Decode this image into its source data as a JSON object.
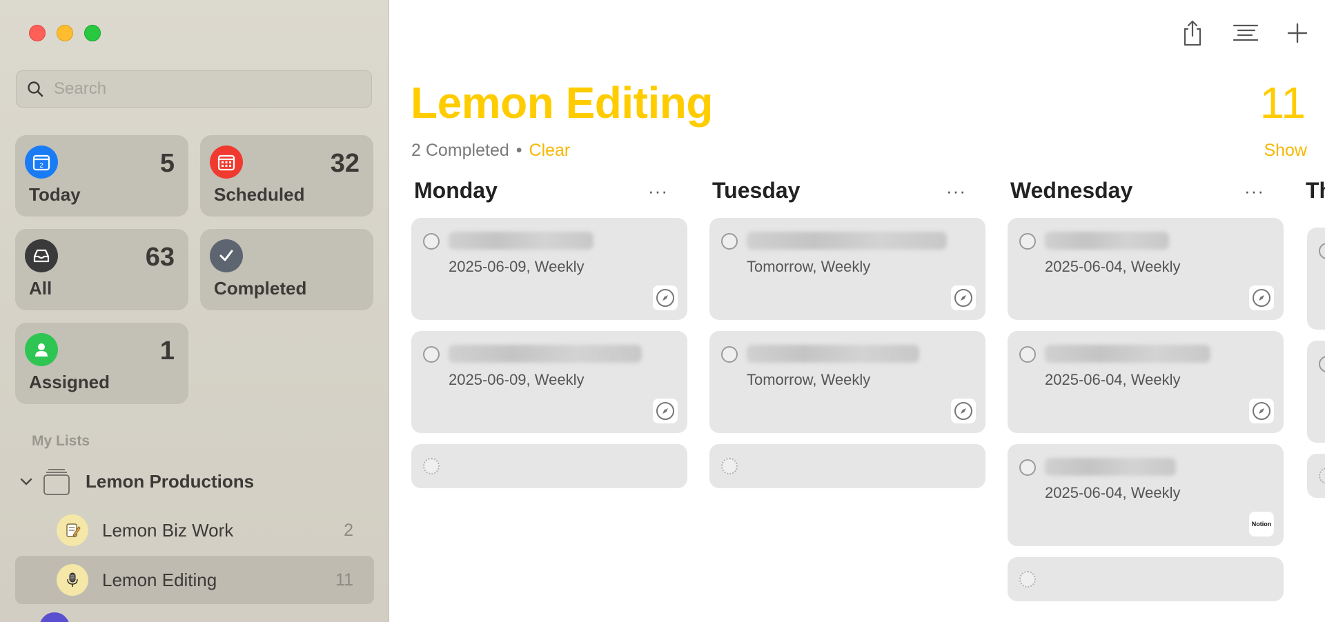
{
  "sidebar": {
    "search_placeholder": "Search",
    "smart_lists": [
      {
        "name": "Today",
        "count": "5",
        "icon": "calendar-day-icon",
        "color": "#1a7cf5"
      },
      {
        "name": "Scheduled",
        "count": "32",
        "icon": "calendar-grid-icon",
        "color": "#f03a2f"
      },
      {
        "name": "All",
        "count": "63",
        "icon": "tray-icon",
        "color": "#3a3a3a"
      },
      {
        "name": "Completed",
        "count": "",
        "icon": "checkmark-icon",
        "color": "#5d6570"
      },
      {
        "name": "Assigned",
        "count": "1",
        "icon": "person-icon",
        "color": "#2fc553"
      }
    ],
    "my_lists_header": "My Lists",
    "group": {
      "name": "Lemon Productions"
    },
    "lists": [
      {
        "name": "Lemon Biz Work",
        "count": "2",
        "icon": "notepad-icon"
      },
      {
        "name": "Lemon Editing",
        "count": "11",
        "icon": "microphone-icon",
        "selected": true
      }
    ]
  },
  "main": {
    "title": "Lemon Editing",
    "count": "11",
    "completed_text": "2 Completed",
    "separator": "•",
    "clear_label": "Clear",
    "show_label": "Show",
    "accent_color": "#ffcc00",
    "columns": [
      {
        "title": "Monday",
        "more": "···",
        "cards": [
          {
            "due": "2025-06-09, Weekly",
            "badge": "safari-icon"
          },
          {
            "due": "2025-06-09, Weekly",
            "badge": "safari-icon"
          }
        ]
      },
      {
        "title": "Tuesday",
        "more": "···",
        "cards": [
          {
            "due": "Tomorrow, Weekly",
            "badge": "safari-icon"
          },
          {
            "due": "Tomorrow, Weekly",
            "badge": "safari-icon"
          }
        ]
      },
      {
        "title": "Wednesday",
        "more": "···",
        "cards": [
          {
            "due": "2025-06-04, Weekly",
            "badge": "safari-icon"
          },
          {
            "due": "2025-06-04, Weekly",
            "badge": "safari-icon"
          },
          {
            "due": "2025-06-04, Weekly",
            "badge": "notion-icon",
            "badge_text": "Notion"
          }
        ]
      },
      {
        "title": "Th"
      }
    ]
  }
}
